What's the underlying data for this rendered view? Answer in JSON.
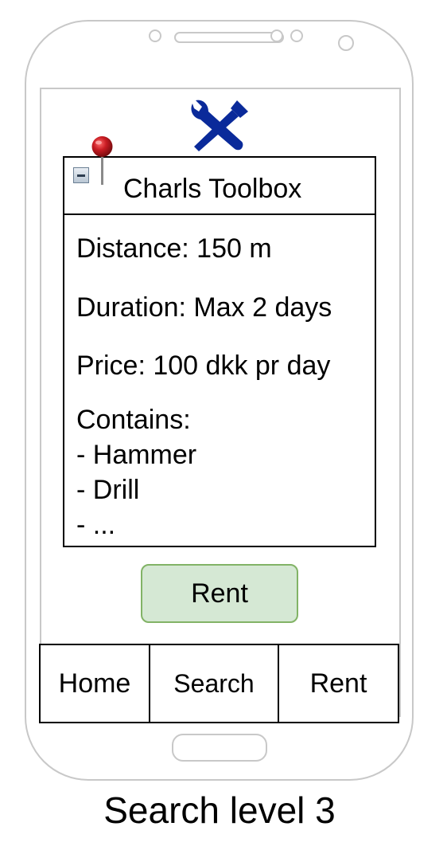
{
  "card": {
    "title": "Charls Toolbox",
    "distance": "Distance: 150 m",
    "duration": "Duration: Max 2 days",
    "price": "Price: 100 dkk pr day",
    "contains_label": "Contains:",
    "contents": [
      "- Hammer",
      "- Drill",
      "- ..."
    ]
  },
  "rent_button": "Rent",
  "tabs": [
    {
      "label": "Home"
    },
    {
      "label": "Search"
    },
    {
      "label": "Rent"
    }
  ],
  "caption": "Search level 3",
  "icons": {
    "logo": "wrench-screwdriver-icon",
    "pin": "map-pin-icon",
    "collapse": "collapse-icon"
  },
  "colors": {
    "logo": "#0a2a9a",
    "pin": "#b0151b",
    "button_fill": "#d5e8d4",
    "button_border": "#82b366",
    "device_outline": "#c8c8c8"
  }
}
